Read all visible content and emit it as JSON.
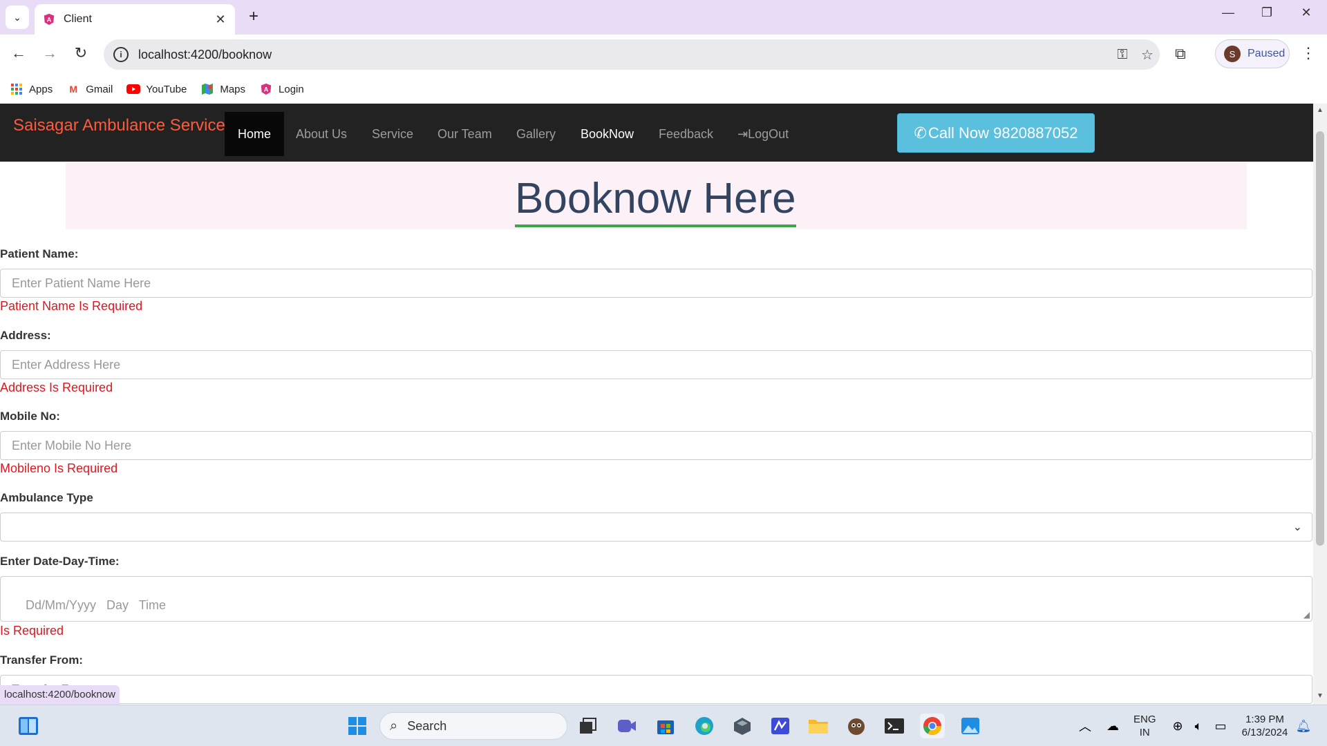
{
  "browser": {
    "tab_title": "Client",
    "url": "localhost:4200/booknow",
    "profile_initial": "S",
    "profile_status": "Paused",
    "bookmarks": [
      {
        "label": "Apps",
        "icon": "apps-grid-icon"
      },
      {
        "label": "Gmail",
        "icon": "gmail-icon"
      },
      {
        "label": "YouTube",
        "icon": "youtube-icon"
      },
      {
        "label": "Maps",
        "icon": "maps-icon"
      },
      {
        "label": "Login",
        "icon": "angular-icon"
      }
    ],
    "status_url": "localhost:4200/booknow"
  },
  "site": {
    "brand": "Saisagar Ambulance Service",
    "nav": [
      {
        "label": "Home",
        "state": "active"
      },
      {
        "label": "About Us"
      },
      {
        "label": "Service"
      },
      {
        "label": "Our Team"
      },
      {
        "label": "Gallery"
      },
      {
        "label": "BookNow",
        "state": "bright"
      },
      {
        "label": "Feedback"
      },
      {
        "label": "LogOut",
        "icon": "logout-icon"
      }
    ],
    "call_button": "Call Now 9820887052",
    "heading": "Booknow Here",
    "colors": {
      "brand": "#ff5a3c",
      "navbar": "#222222",
      "call": "#5bc0de",
      "heading": "#324460",
      "underline": "#3ca550",
      "error": "#e0161e",
      "hero_bg": "#fdf1f8"
    }
  },
  "form": {
    "patient_label": "Patient Name:",
    "patient_placeholder": "Enter Patient Name Here",
    "patient_error": "Patient Name Is Required",
    "address_label": "Address:",
    "address_placeholder": "Enter Address Here",
    "address_error": "Address Is Required",
    "mobile_label": "Mobile No:",
    "mobile_placeholder": "Enter Mobile No Here",
    "mobile_error": "Mobileno Is Required",
    "ambulance_label": "Ambulance Type",
    "ambulance_value": "",
    "date_label": "Enter Date-Day-Time:",
    "date_placeholder": "Dd/Mm/Yyyy   Day   Time",
    "date_error": "Is Required",
    "transfer_label": "Transfer From:",
    "transfer_placeholder": "Transfer From"
  },
  "taskbar": {
    "search_label": "Search",
    "lang_top": "ENG",
    "lang_bottom": "IN",
    "time": "1:39 PM",
    "date": "6/13/2024"
  }
}
